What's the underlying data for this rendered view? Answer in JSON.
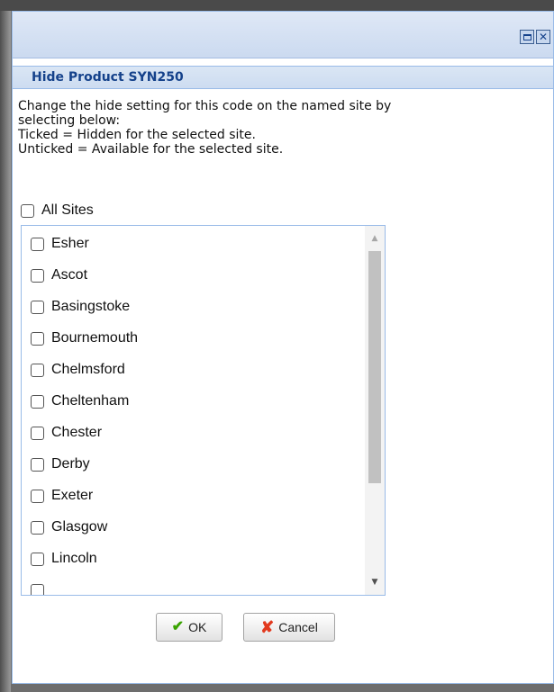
{
  "window": {
    "header_title": "Hide Product SYN250"
  },
  "description": {
    "lines": [
      "Change the hide setting for this code on the named site by",
      "selecting below:",
      "Ticked = Hidden for the selected site.",
      "Unticked = Available for the selected site."
    ]
  },
  "all_sites": {
    "label": "All Sites",
    "checked": false
  },
  "sites": [
    {
      "label": "Esher",
      "checked": false
    },
    {
      "label": "Ascot",
      "checked": false
    },
    {
      "label": "Basingstoke",
      "checked": false
    },
    {
      "label": "Bournemouth",
      "checked": false
    },
    {
      "label": "Chelmsford",
      "checked": false
    },
    {
      "label": "Cheltenham",
      "checked": false
    },
    {
      "label": "Chester",
      "checked": false
    },
    {
      "label": "Derby",
      "checked": false
    },
    {
      "label": "Exeter",
      "checked": false
    },
    {
      "label": "Glasgow",
      "checked": false
    },
    {
      "label": "Lincoln",
      "checked": false
    }
  ],
  "buttons": {
    "ok_label": "OK",
    "cancel_label": "Cancel"
  },
  "icons": {
    "ok": "check-icon",
    "cancel": "cross-icon",
    "maximize": "maximize-icon",
    "close": "close-icon"
  },
  "colors": {
    "header_text": "#15428b",
    "border": "#99bbe8",
    "ok_icon": "#3aa300",
    "cancel_icon": "#e23a1f"
  }
}
